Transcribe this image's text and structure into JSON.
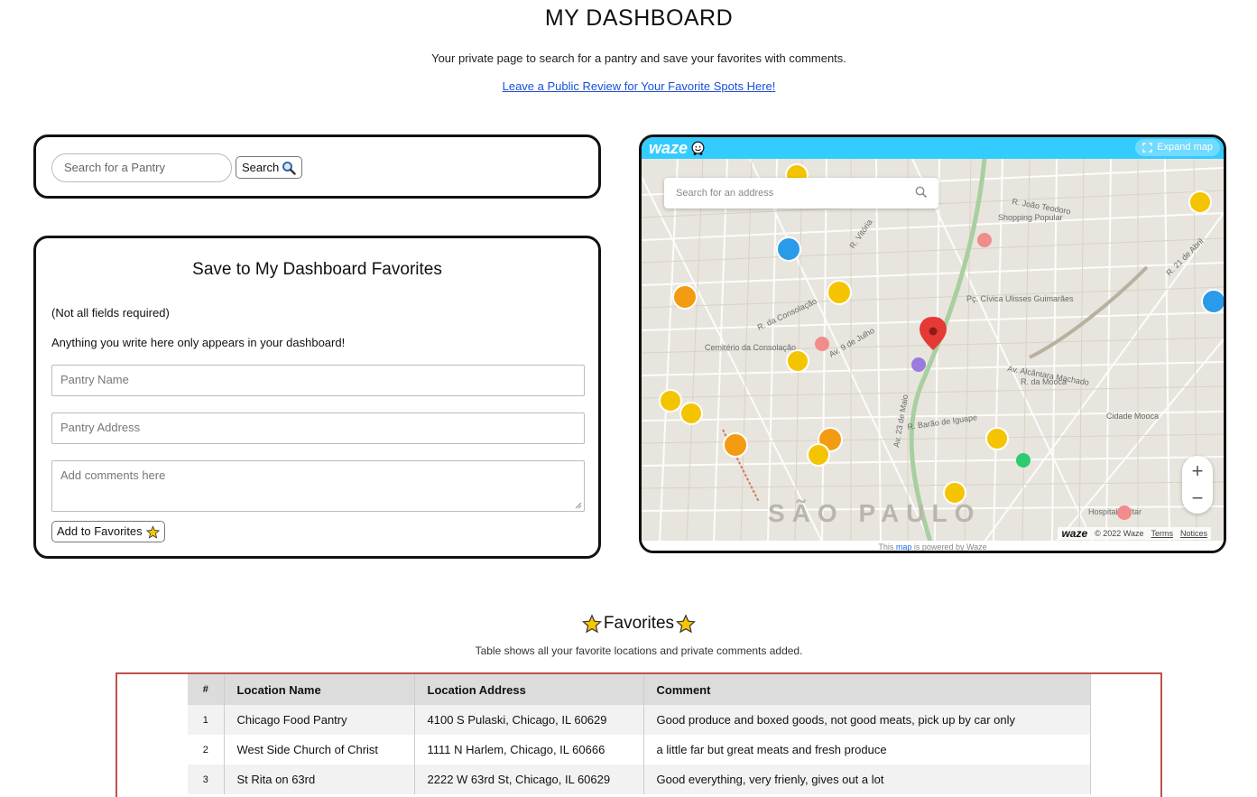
{
  "header": {
    "title": "MY DASHBOARD",
    "subtitle": "Your private page to search for a pantry and save your favorites with comments.",
    "review_link": "Leave a Public Review for Your Favorite Spots Here!"
  },
  "search": {
    "placeholder": "Search for a Pantry",
    "button_label": "Search"
  },
  "save_form": {
    "title": "Save to My Dashboard Favorites",
    "note_required": "(Not all fields required)",
    "note_private": "Anything you write here only appears in your dashboard!",
    "name_placeholder": "Pantry Name",
    "address_placeholder": "Pantry Address",
    "comments_placeholder": "Add comments here",
    "submit_label": "Add to Favorites"
  },
  "map": {
    "brand": "waze",
    "expand_label": "Expand map",
    "search_placeholder": "Search for an address",
    "zoom_in": "+",
    "zoom_out": "−",
    "footer_brand": "waze",
    "copyright": "© 2022 Waze",
    "terms": "Terms",
    "notices": "Notices",
    "powered_prefix": "This",
    "powered_link": "map",
    "powered_suffix": "is powered by Waze",
    "city_label": "SÃO PAULO",
    "street_labels": [
      "R. da Consolação",
      "Av. 9 de Julho",
      "R. Vitória",
      "Av. 23 de Maio",
      "R. Barão de Iguape",
      "Av. Alcântara Machado",
      "R. da Mooca",
      "Cemitério da Consolação",
      "Pç. Cívica Ulisses Guimarães",
      "R. João Teodoro",
      "Shopping Popular",
      "R. 21 de Abril",
      "Cidade Mooca",
      "Hospital Militar"
    ],
    "colors": {
      "header": "#33ccff",
      "pin": "#e53935",
      "marker": "#f5c400"
    }
  },
  "favorites": {
    "title": "Favorites",
    "subtitle": "Table shows all your favorite locations and private comments added.",
    "columns": [
      "#",
      "Location Name",
      "Location Address",
      "Comment"
    ],
    "rows": [
      {
        "num": "1",
        "name": "Chicago Food Pantry",
        "address": "4100 S Pulaski, Chicago, IL 60629",
        "comment": "Good produce and boxed goods, not good meats, pick up by car only"
      },
      {
        "num": "2",
        "name": "West Side Church of Christ",
        "address": "1111 N Harlem, Chicago, IL 60666",
        "comment": "a little far but great meats and fresh produce"
      },
      {
        "num": "3",
        "name": "St Rita on 63rd",
        "address": "2222 W 63rd St, Chicago, IL 60629",
        "comment": "Good everything, very frienly, gives out a lot"
      }
    ]
  }
}
